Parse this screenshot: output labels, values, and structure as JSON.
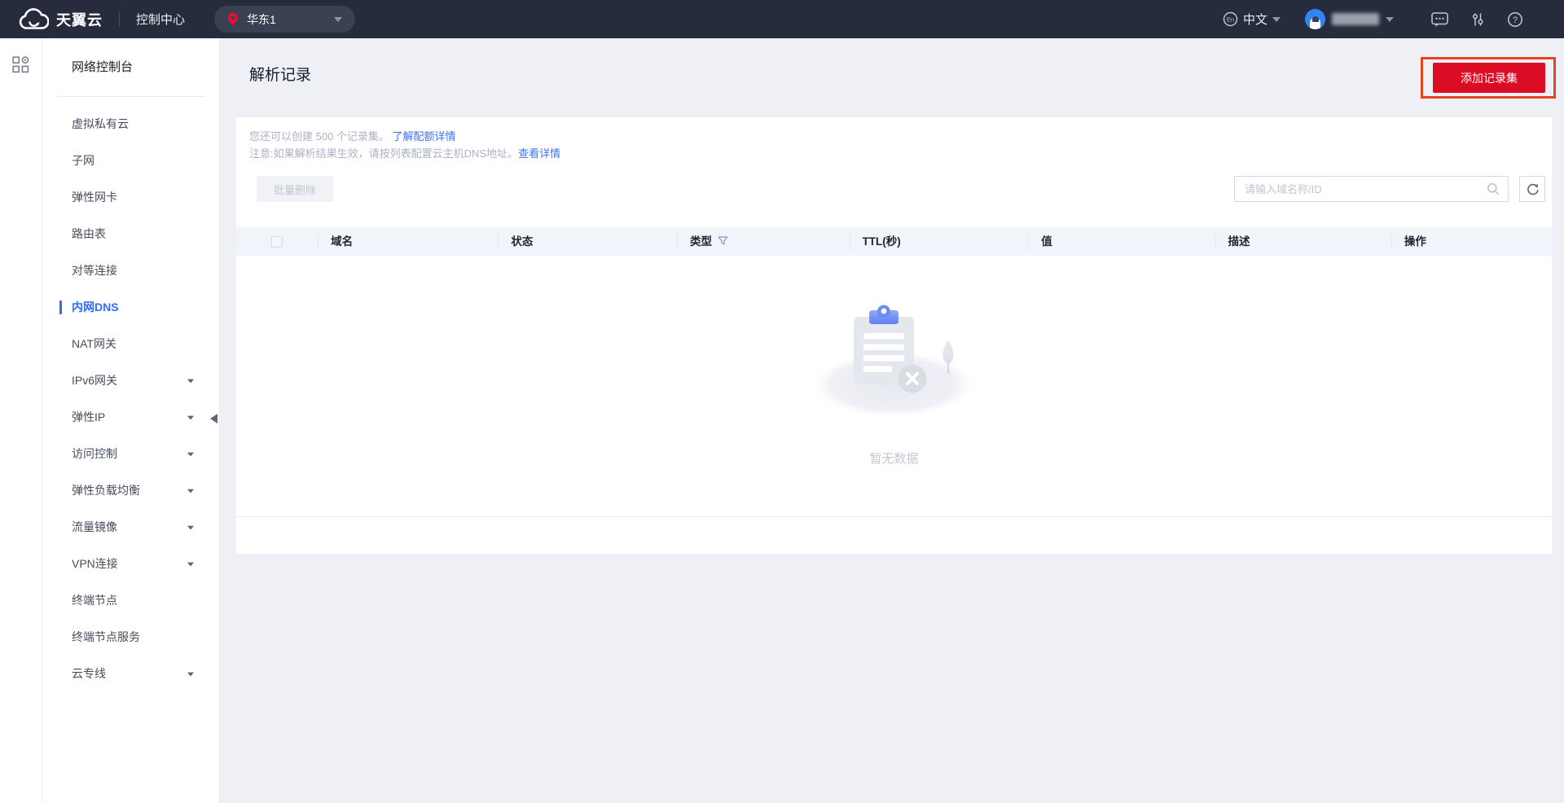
{
  "topbar": {
    "brand": "天翼云",
    "console_label": "控制中心",
    "region": "华东1",
    "lang_badge": "En",
    "lang_label": "中文"
  },
  "sidebar": {
    "title": "网络控制台",
    "items": [
      {
        "label": "虚拟私有云",
        "selected": false,
        "expandable": false
      },
      {
        "label": "子网",
        "selected": false,
        "expandable": false
      },
      {
        "label": "弹性网卡",
        "selected": false,
        "expandable": false
      },
      {
        "label": "路由表",
        "selected": false,
        "expandable": false
      },
      {
        "label": "对等连接",
        "selected": false,
        "expandable": false
      },
      {
        "label": "内网DNS",
        "selected": true,
        "expandable": false
      },
      {
        "label": "NAT网关",
        "selected": false,
        "expandable": false
      },
      {
        "label": "IPv6网关",
        "selected": false,
        "expandable": true
      },
      {
        "label": "弹性IP",
        "selected": false,
        "expandable": true
      },
      {
        "label": "访问控制",
        "selected": false,
        "expandable": true
      },
      {
        "label": "弹性负载均衡",
        "selected": false,
        "expandable": true
      },
      {
        "label": "流量镜像",
        "selected": false,
        "expandable": true
      },
      {
        "label": "VPN连接",
        "selected": false,
        "expandable": true
      },
      {
        "label": "终端节点",
        "selected": false,
        "expandable": false
      },
      {
        "label": "终端节点服务",
        "selected": false,
        "expandable": false
      },
      {
        "label": "云专线",
        "selected": false,
        "expandable": true
      }
    ]
  },
  "page": {
    "title": "解析记录",
    "add_button_label": "添加记录集",
    "quota_notice": "您还可以创建 500 个记录集。",
    "quota_link": "了解配额详情",
    "dns_notice": "注意:如果解析结果生效，请按列表配置云主机DNS地址。",
    "dns_link": "查看详情",
    "toolbar": {
      "batch_delete_label": "批量删除",
      "search_placeholder": "请输入域名称/ID"
    },
    "table": {
      "headers": [
        "域名",
        "状态",
        "类型",
        "TTL(秒)",
        "值",
        "描述",
        "操作"
      ],
      "rows": []
    },
    "empty_text": "暂无数据"
  },
  "colors": {
    "topbar_bg": "#262c3b",
    "accent_red": "#dc0c25",
    "annotation_red": "#e8431f",
    "link_blue": "#3d73f5",
    "selected_blue": "#2f6bff",
    "page_bg": "#eef0f5",
    "table_header_bg": "#f2f4fb"
  }
}
